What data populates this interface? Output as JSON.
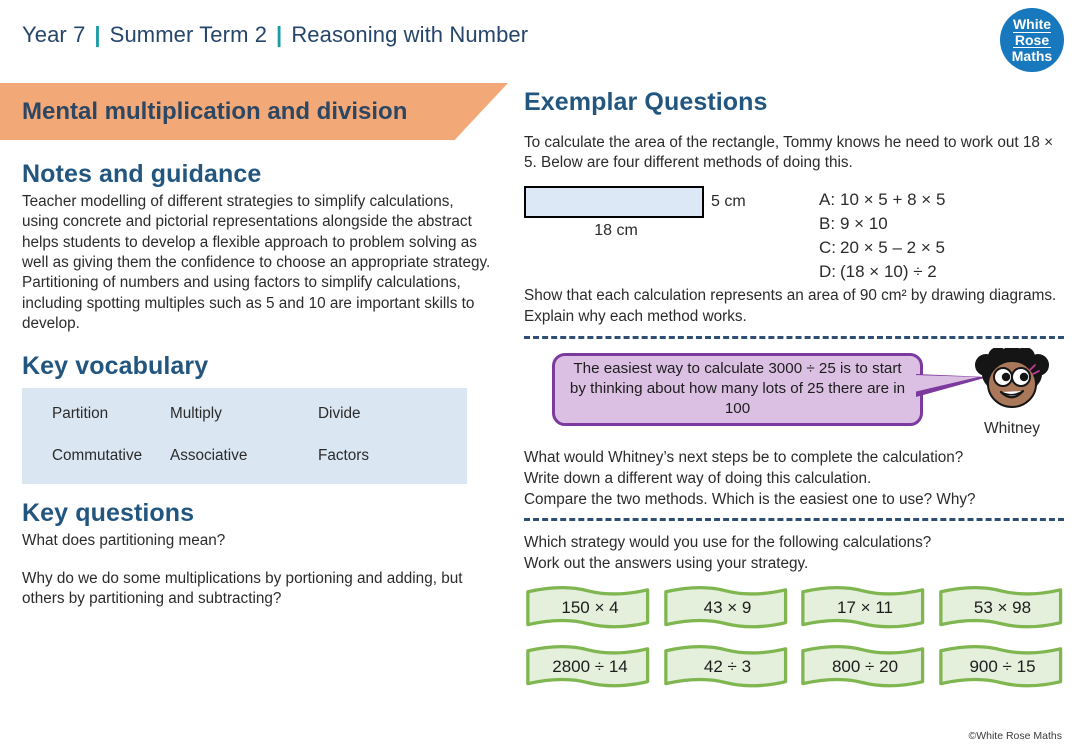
{
  "header": {
    "year": "Year 7",
    "term": "Summer Term 2",
    "unit": "Reasoning with Number",
    "separator": "|"
  },
  "logo": {
    "line1": "White",
    "line2": "Rose",
    "line3": "Maths"
  },
  "banner": {
    "title": "Mental multiplication and division",
    "color": "#f2a877"
  },
  "notes": {
    "heading": "Notes and guidance",
    "body": "Teacher modelling of different strategies to simplify calculations, using concrete and pictorial representations alongside the abstract helps students to develop a flexible approach to problem solving as well as giving them the confidence to choose an appropriate strategy. Partitioning of numbers and using factors to simplify calculations, including spotting multiples such as 5 and 10 are important skills to develop."
  },
  "vocabulary": {
    "heading": "Key vocabulary",
    "rows": [
      [
        "Partition",
        "Multiply",
        "Divide"
      ],
      [
        "Commutative",
        "Associative",
        "Factors"
      ]
    ]
  },
  "key_questions": {
    "heading": "Key questions",
    "items": [
      "What does partitioning mean?",
      "Why do we do some multiplications by portioning and adding, but others by partitioning and subtracting?"
    ]
  },
  "exemplar": {
    "heading": "Exemplar Questions",
    "q1": {
      "intro": "To calculate the area of the rectangle, Tommy knows he need to work out 18 × 5. Below are four different methods of doing this.",
      "rectangle": {
        "width_label": "18 cm",
        "height_label": "5 cm",
        "fill": "#dce8f6"
      },
      "methods": [
        {
          "key": "A:",
          "expr": "10 × 5 + 8 × 5"
        },
        {
          "key": "B:",
          "expr": "9 × 10"
        },
        {
          "key": "C:",
          "expr": "20 × 5 – 2 × 5"
        },
        {
          "key": "D:",
          "expr": "(18 × 10) ÷ 2"
        }
      ],
      "outro": "Show that each calculation represents an area of 90 cm² by drawing diagrams. Explain why each method works."
    },
    "q2": {
      "bubble_text": "The easiest way to calculate 3000 ÷ 25 is to start by thinking about how many lots of 25 there are in 100",
      "character_name": "Whitney",
      "bubble_fill": "#dcc0e4",
      "bubble_stroke": "#7c3a9e",
      "prompts": [
        "What would Whitney’s next steps be to complete the calculation?",
        "Write down a different way of doing this calculation.",
        "Compare the two methods. Which is the easiest one to use? Why?"
      ]
    },
    "q3": {
      "prompts": [
        "Which strategy would you use for the following calculations?",
        "Work out the answers using your strategy."
      ],
      "flag_rows": [
        [
          "150 × 4",
          "43 × 9",
          "17 × 11",
          "53 × 98"
        ],
        [
          "2800 ÷ 14",
          "42 ÷ 3",
          "800 ÷ 20",
          "900 ÷ 15"
        ]
      ],
      "flag_fill": "#e4efdc",
      "flag_stroke": "#7fb650"
    }
  },
  "footer": {
    "copyright": "©White Rose Maths"
  }
}
